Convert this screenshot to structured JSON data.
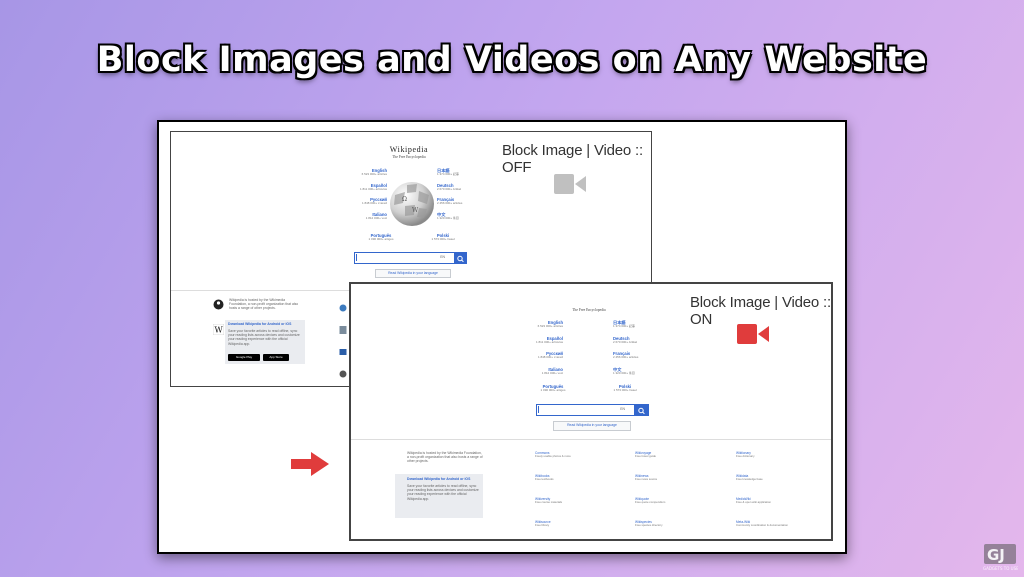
{
  "headline": "Block Images and Videos on Any Website",
  "colors": {
    "arrow": "#e03c3c",
    "icon_on": "#e03c3c",
    "icon_off": "#c0c0c0",
    "link": "#3366cc"
  },
  "off_panel": {
    "label": "Block Image | Video :: OFF",
    "wiki_title": "Wikipedia",
    "wiki_subtitle": "The Free Encyclopedia",
    "langs_left": [
      {
        "name": "English",
        "count": "6 523 000+ articles"
      },
      {
        "name": "Español",
        "count": "1 811 000+ artículos"
      },
      {
        "name": "Русский",
        "count": "1 848 000+ статей"
      },
      {
        "name": "Italiano",
        "count": "1 812 000+ voci"
      }
    ],
    "langs_right": [
      {
        "name": "日本語",
        "count": "1 374 000+ 記事"
      },
      {
        "name": "Deutsch",
        "count": "2 670 000+ Artikel"
      },
      {
        "name": "Français",
        "count": "2 456 000+ articles"
      },
      {
        "name": "中文",
        "count": "1 320 000+ 条目"
      }
    ],
    "lang_bottom_left": {
      "name": "Português",
      "count": "1 090 000+ artigos"
    },
    "lang_bottom_right": {
      "name": "Polski",
      "count": "1 573 000+ haseł"
    },
    "search_lang": "EN",
    "read_button": "Read Wikipedia in your language",
    "hosted_text": "Wikipedia is hosted by the Wikimedia Foundation, a non-profit organization that also hosts a range of other projects.",
    "download_title": "Download Wikipedia for Android or iOS",
    "download_text": "Save your favorite articles to read offline, sync your reading lists across devices and customize your reading experience with the official Wikipedia app.",
    "google_play": "Google Play",
    "app_store": "App Store"
  },
  "on_panel": {
    "label": "Block Image | Video :: ON",
    "wiki_subtitle": "The Free Encyclopedia",
    "langs_left": [
      {
        "name": "English",
        "count": "6 523 000+ articles"
      },
      {
        "name": "Español",
        "count": "1 811 000+ artículos"
      },
      {
        "name": "Русский",
        "count": "1 848 000+ статей"
      },
      {
        "name": "Italiano",
        "count": "1 812 000+ voci"
      }
    ],
    "langs_right": [
      {
        "name": "日本語",
        "count": "1 374 000+ 記事"
      },
      {
        "name": "Deutsch",
        "count": "2 670 000+ Artikel"
      },
      {
        "name": "Français",
        "count": "2 456 000+ articles"
      },
      {
        "name": "中文",
        "count": "1 320 000+ 条目"
      }
    ],
    "lang_bottom_left": {
      "name": "Português",
      "count": "1 090 000+ artigos"
    },
    "lang_bottom_right": {
      "name": "Polski",
      "count": "1 573 000+ haseł"
    },
    "search_lang": "EN",
    "read_button": "Read Wikipedia in your language",
    "hosted_text": "Wikipedia is hosted by the Wikimedia Foundation, a non-profit organization that also hosts a range of other projects.",
    "download_title": "Download Wikipedia for Android or iOS",
    "download_text": "Save your favorite articles to read offline, sync your reading lists across devices and customize your reading experience with the official Wikipedia app.",
    "projects": [
      {
        "title": "Commons",
        "sub": "Freely usable photos & more"
      },
      {
        "title": "Wikivoyage",
        "sub": "Free travel guide"
      },
      {
        "title": "Wiktionary",
        "sub": "Free dictionary"
      },
      {
        "title": "Wikibooks",
        "sub": "Free textbooks"
      },
      {
        "title": "Wikinews",
        "sub": "Free news source"
      },
      {
        "title": "Wikidata",
        "sub": "Free knowledge base"
      },
      {
        "title": "Wikiversity",
        "sub": "Free course materials"
      },
      {
        "title": "Wikiquote",
        "sub": "Free quote compendium"
      },
      {
        "title": "MediaWiki",
        "sub": "Free & open wiki application"
      },
      {
        "title": "Wikisource",
        "sub": "Free library"
      },
      {
        "title": "Wikispecies",
        "sub": "Free species directory"
      },
      {
        "title": "Meta-Wiki",
        "sub": "Community coordination & documentation"
      }
    ]
  },
  "watermark": "GADGETS TO USE"
}
